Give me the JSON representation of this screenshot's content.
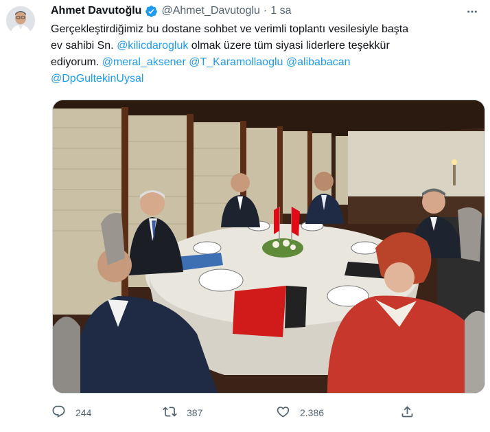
{
  "tweet": {
    "author_name": "Ahmet Davutoğlu",
    "handle": "@Ahmet_Davutoglu",
    "separator": "·",
    "time": "1 sa",
    "text": {
      "l1": "Gerçekleştirdiğimiz bu dostane sohbet ve verimli toplantı vesilesiyle başta",
      "l2_pre": "ev sahibi Sn. ",
      "mention_1": "@kilicdarogluk",
      "l2_post": " olmak üzere tüm siyasi liderlere teşekkür",
      "l3_pre": "ediyorum. ",
      "mention_2": "@meral_aksener",
      "mention_3": "@T_Karamollaoglu",
      "mention_4": "@alibabacan",
      "mention_5": "@DpGultekinUysal"
    },
    "stats": {
      "replies": "244",
      "retweets": "387",
      "likes": "2.386"
    }
  },
  "icons": {
    "verified": "verified-badge-icon",
    "more": "more-dots-icon",
    "reply": "reply-icon",
    "retweet": "retweet-icon",
    "like": "heart-icon",
    "share": "share-icon"
  },
  "colors": {
    "link": "#1d9bf0",
    "secondary_text": "#536471",
    "verified": "#1d9bf0",
    "flag_red": "#e30a17"
  }
}
